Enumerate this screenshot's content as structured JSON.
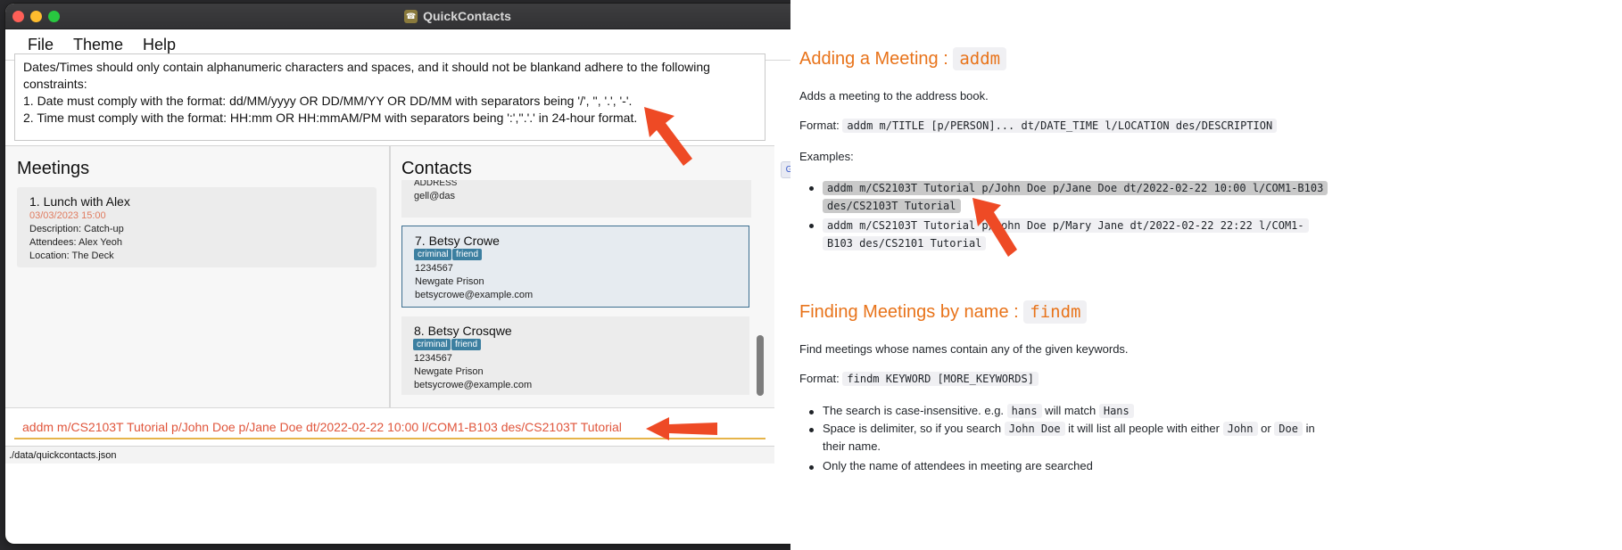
{
  "window": {
    "title": "QuickContacts"
  },
  "menu": {
    "items": [
      "File",
      "Theme",
      "Help"
    ]
  },
  "result": {
    "lines": [
      "Dates/Times should only contain alphanumeric characters and spaces, and it should not be blankand adhere to the following",
      "constraints:",
      "1. Date must comply with the format: dd/MM/yyyy OR DD/MM/YY OR DD/MM with separators being '/', '', '.', '-'.",
      "2. Time must comply with the format: HH:mm OR HH:mmAM/PM with separators being ':',''.'.' in 24-hour format."
    ]
  },
  "meetings": {
    "title": "Meetings",
    "items": [
      {
        "name": "1.  Lunch with Alex",
        "date": "03/03/2023 15:00",
        "description": "Description: Catch-up",
        "attendees": "Attendees: Alex Yeoh",
        "location": "Location: The Deck"
      }
    ]
  },
  "contacts": {
    "title": "Contacts",
    "partial": {
      "address": "ADDRESS",
      "email": "gell@das"
    },
    "items": [
      {
        "name": "7.  Betsy Crowe",
        "tags": [
          "criminal",
          "friend"
        ],
        "phone": "1234567",
        "address": "Newgate Prison",
        "email": "betsycrowe@example.com"
      },
      {
        "name": "8.  Betsy Crosqwe",
        "tags": [
          "criminal",
          "friend"
        ],
        "phone": "1234567",
        "address": "Newgate Prison",
        "email": "betsycrowe@example.com"
      }
    ]
  },
  "command": {
    "value": "addm m/CS2103T Tutorial p/John Doe p/Jane Doe dt/2022-02-22 10:00 l/COM1-B103 des/CS2103T Tutorial"
  },
  "status": {
    "path": "./data/quickcontacts.json"
  },
  "doc": {
    "section1": {
      "heading": "Adding a Meeting : ",
      "heading_code": "addm",
      "intro": "Adds a meeting to the address book.",
      "format_label": "Format: ",
      "format_code": "addm m/TITLE [p/PERSON]... dt/DATE_TIME l/LOCATION des/DESCRIPTION",
      "examples_label": "Examples:",
      "example1_line1": "addm m/CS2103T Tutorial p/John Doe p/Jane Doe dt/2022-02-22 10:00 l/COM1-B103",
      "example1_line2": "des/CS2103T Tutorial",
      "example2_line1": "addm m/CS2103T Tutorial p/John Doe p/Mary Jane dt/2022-02-22 22:22 l/COM1-",
      "example2_line2": "B103 des/CS2101 Tutorial"
    },
    "section2": {
      "heading": "Finding Meetings by name : ",
      "heading_code": "findm",
      "intro": "Find meetings whose names contain any of the given keywords.",
      "format_label": "Format: ",
      "format_code": "findm KEYWORD [MORE_KEYWORDS]",
      "b1_pre": "The search is case-insensitive. e.g. ",
      "b1_code1": "hans",
      "b1_mid": " will match ",
      "b1_code2": "Hans",
      "b2_pre": "Space is delimiter, so if you search ",
      "b2_code1": "John Doe",
      "b2_mid": " it will list all people with either ",
      "b2_code2": "John",
      "b2_or": " or ",
      "b2_code3": "Doe",
      "b2_post": " in",
      "b2_line2": "their name.",
      "b3": "Only the name of attendees in meeting are searched"
    }
  },
  "colors": {
    "accent": "#e8731a",
    "error_text": "#e0553b",
    "tag": "#3c7fa0",
    "arrow": "#ee4a25"
  }
}
